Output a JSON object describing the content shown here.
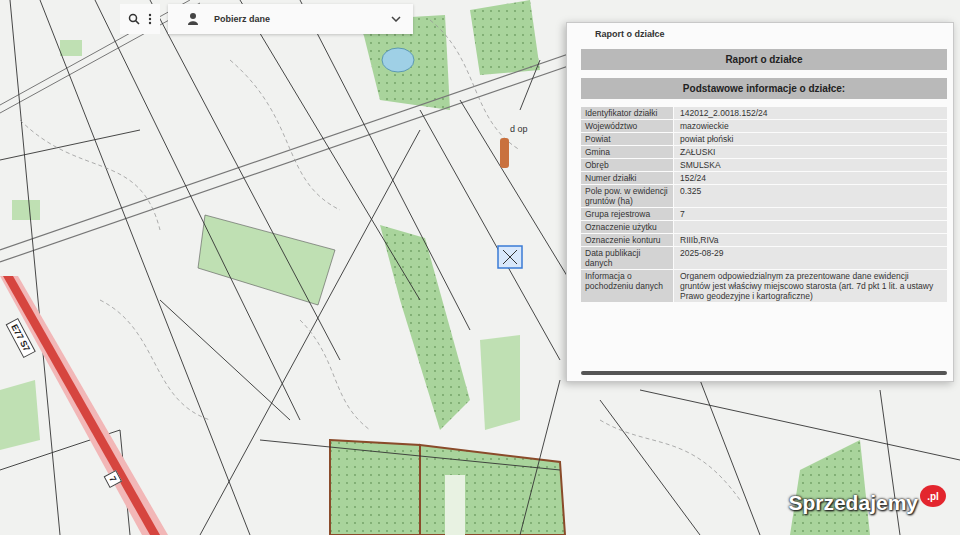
{
  "toolbar": {
    "download_label": "Pobierz dane"
  },
  "map": {
    "labels": [
      {
        "text": "E77 S7"
      },
      {
        "text": "7"
      },
      {
        "text": "d op"
      }
    ]
  },
  "report": {
    "title": "Raport o działce",
    "heading": "Raport o działce",
    "subheading": "Podstawowe informacje o działce:",
    "rows": [
      {
        "label": "Identyfikator działki",
        "value": "142012_2.0018.152/24"
      },
      {
        "label": "Województwo",
        "value": "mazowieckie"
      },
      {
        "label": "Powiat",
        "value": "powiat płoński"
      },
      {
        "label": "Gmina",
        "value": "ZAŁUSKI"
      },
      {
        "label": "Obręb",
        "value": "SMULSKA"
      },
      {
        "label": "Numer działki",
        "value": "152/24"
      },
      {
        "label": "Pole pow. w ewidencji gruntów (ha)",
        "value": "0.325"
      },
      {
        "label": "Grupa rejestrowa",
        "value": "7"
      },
      {
        "label": "Oznaczenie użytku",
        "value": ""
      },
      {
        "label": "Oznaczenie konturu",
        "value": "RIIIb,RIVa"
      },
      {
        "label": "Data publikacji danych",
        "value": "2025-08-29"
      },
      {
        "label": "Informacja o pochodzeniu danych",
        "value": "Organem odpowiedzialnym za prezentowane dane ewidencji gruntów jest właściwy miejscowo starosta (art. 7d pkt 1 lit. a ustawy Prawo geodezyjne i kartograficzne)"
      }
    ]
  },
  "watermark": {
    "name": "Sprzedajemy",
    "badge": ".pl"
  }
}
